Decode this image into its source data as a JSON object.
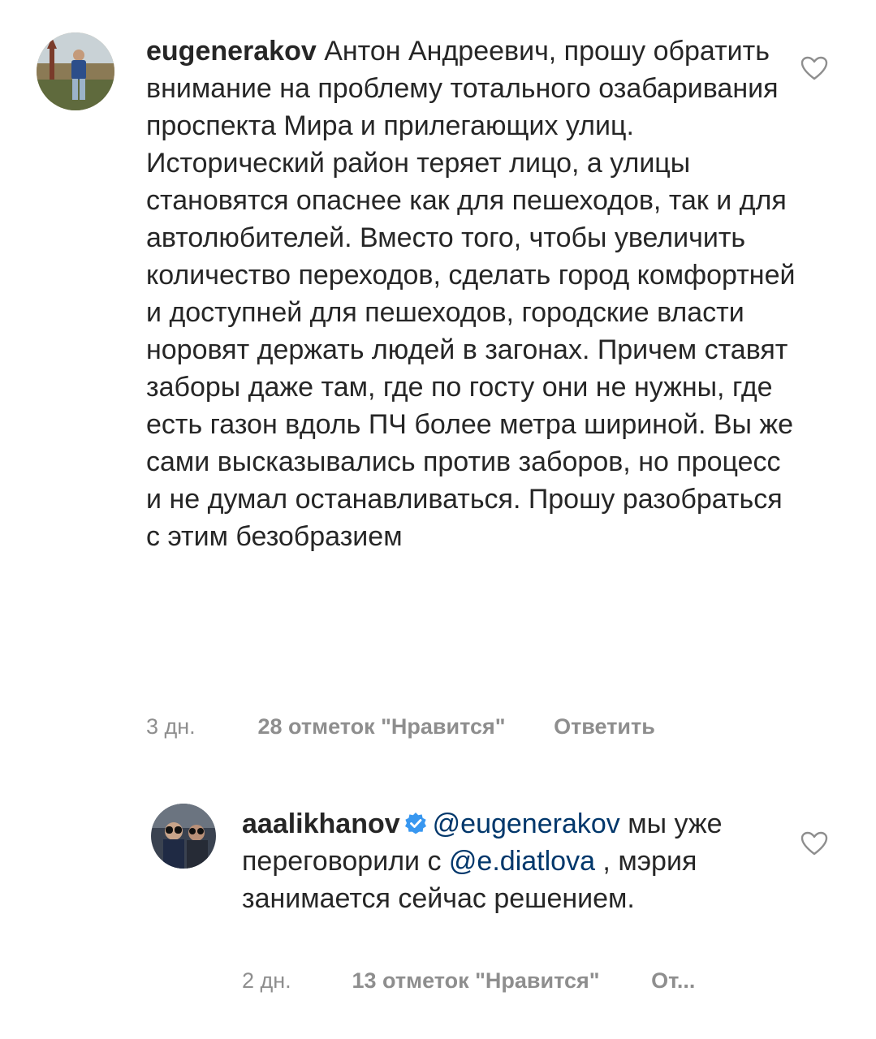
{
  "comments": [
    {
      "username": "eugenerakov",
      "text": "Антон Андреевич, прошу обратить внимание на проблему тотального озабаривания проспекта Мира и прилегающих улиц. Исторический район теряет лицо, а улицы становятся опаснее как для пешеходов, так и для автолюбителей. Вместо того, чтобы увеличить количество переходов, сделать город комфортней и доступней для пешеходов, городские власти норовят держать людей в загонах. Причем ставят заборы даже там, где по госту они не нужны, где есть газон вдоль ПЧ более метра шириной. Вы же сами высказывались против заборов, но процесс и не думал останавливаться. Прошу разобраться с этим безобразием",
      "time": "3 дн.",
      "likes": "28 отметок \"Нравится\"",
      "reply": "Ответить"
    },
    {
      "username": "aaalikhanov",
      "verified": true,
      "mention1": "@eugenerakov",
      "text1": " мы уже переговорили с ",
      "mention2": "@e.diatlova",
      "text2": " , мэрия занимается сейчас решением.",
      "time": "2 дн.",
      "likes": "13 отметок \"Нравится\"",
      "reply": "От..."
    }
  ],
  "icons": {
    "like": "heart-outline-icon",
    "verified": "verified-badge-icon"
  },
  "colors": {
    "text": "#262626",
    "meta": "#8e8e8e",
    "mention": "#00376b",
    "verified": "#3897f0"
  }
}
